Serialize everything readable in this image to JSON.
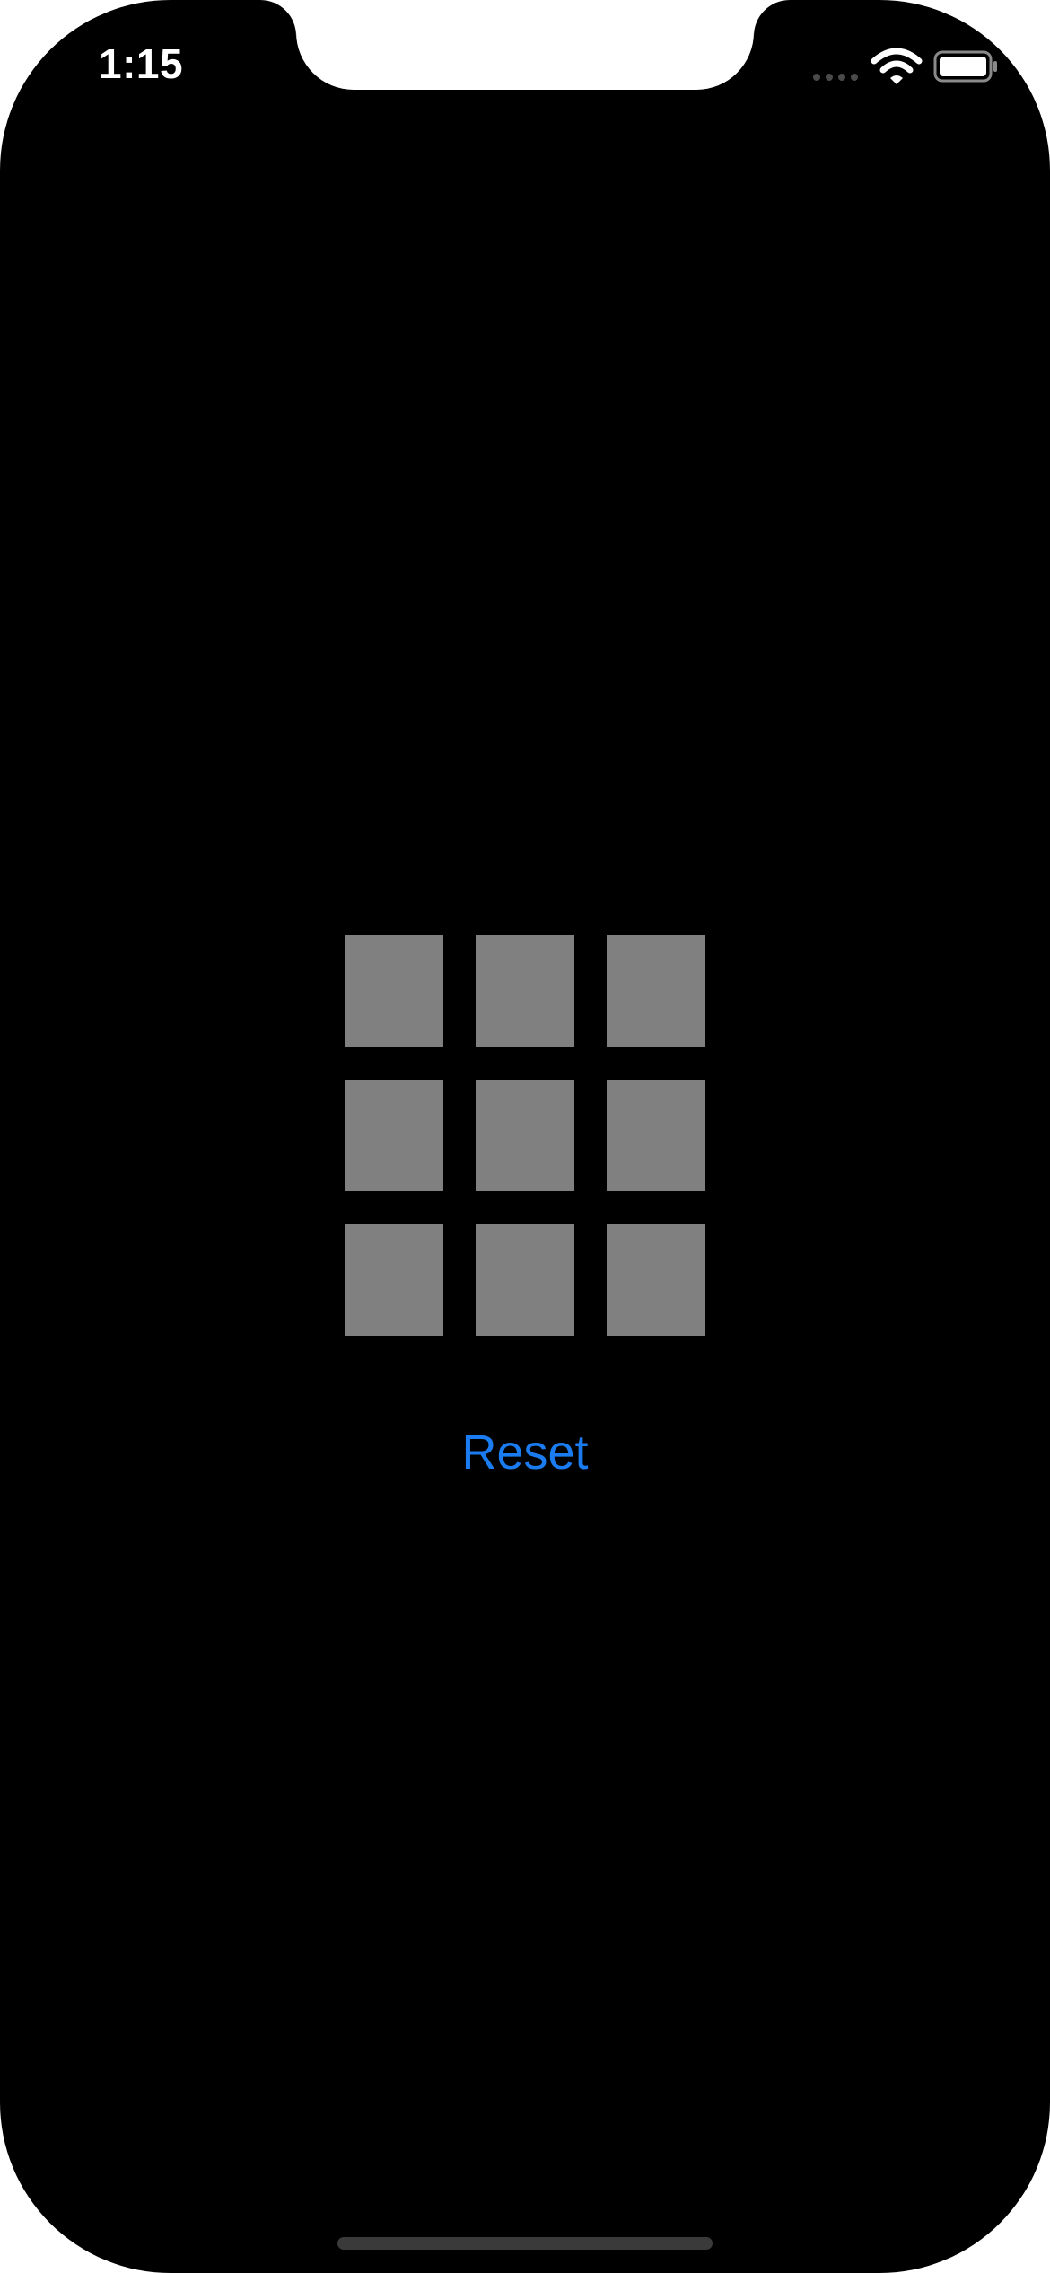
{
  "status_bar": {
    "time": "1:15",
    "wifi_icon": "wifi-icon",
    "battery_icon": "battery-icon"
  },
  "grid": {
    "rows": 3,
    "columns": 3,
    "tile_color": "#808080",
    "tiles": [
      "",
      "",
      "",
      "",
      "",
      "",
      "",
      "",
      ""
    ]
  },
  "reset_button": {
    "label": "Reset",
    "color": "#1a7cf0"
  },
  "background_color": "#000000"
}
